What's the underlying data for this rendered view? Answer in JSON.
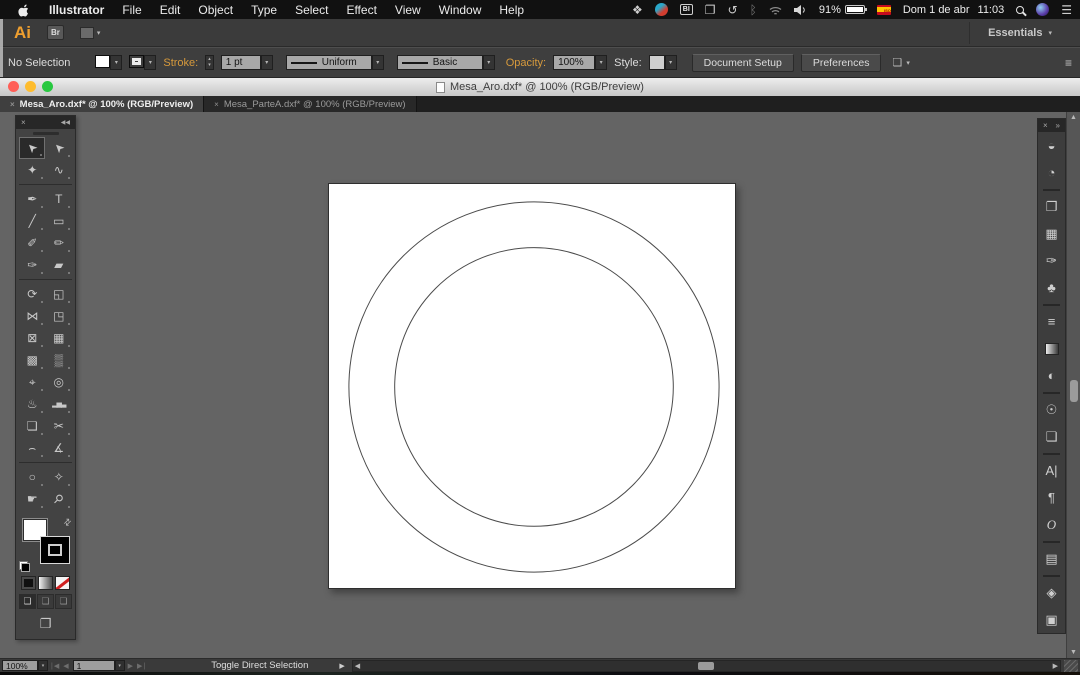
{
  "colors": {
    "accent_orange": "#ef9f2f",
    "gold_label": "#d79a3c",
    "traffic_red": "#ff5f57",
    "traffic_yellow": "#febc2e",
    "traffic_green": "#28c840",
    "flag_red": "#c60b1e",
    "flag_yellow": "#ffc400",
    "pasteboard_grey": "#646464",
    "panel_grey": "#3e3e3e",
    "artboard_white": "#ffffff",
    "circle_stroke": "#4a4a4a"
  },
  "glyphs": {
    "caret": "▾",
    "up": "▴",
    "close": "×",
    "collapse": "◀◀",
    "expand": "»",
    "swap": "⇄",
    "left": "◀",
    "right": "▶",
    "first": "|◀",
    "last": "▶|",
    "up_arrow": "▲",
    "down_arrow": "▼",
    "panel_menu": "≡",
    "notif": "☰",
    "dropbox": "❖",
    "displays": "❐",
    "time_machine": "↺",
    "bluetooth": "ᛒ",
    "select_similar": "❏",
    "screen_mode": "❐",
    "draw_normal": "❏",
    "draw_behind": "❏",
    "draw_inside": "❏",
    "grid_btn": "▦"
  },
  "menubar": {
    "items": [
      {
        "name": "menu-illustrator",
        "label": "Illustrator",
        "cls": "bold"
      },
      {
        "name": "menu-file",
        "label": "File"
      },
      {
        "name": "menu-edit",
        "label": "Edit"
      },
      {
        "name": "menu-object",
        "label": "Object"
      },
      {
        "name": "menu-type",
        "label": "Type"
      },
      {
        "name": "menu-select",
        "label": "Select"
      },
      {
        "name": "menu-effect",
        "label": "Effect"
      },
      {
        "name": "menu-view",
        "label": "View"
      },
      {
        "name": "menu-window",
        "label": "Window"
      },
      {
        "name": "menu-help",
        "label": "Help"
      }
    ],
    "status": {
      "bi_label": "BI",
      "battery_pct": "91%",
      "flag_label": "ISO",
      "date": "Dom 1 de abr",
      "time": "11:03"
    }
  },
  "appbar": {
    "logo": "Ai",
    "bridge": "Br",
    "workspace": "Essentials"
  },
  "controlbar": {
    "selection_status": "No Selection",
    "stroke_label": "Stroke:",
    "stroke_value": "1 pt",
    "width_profile": "Uniform",
    "brush": "Basic",
    "opacity_label": "Opacity:",
    "opacity_value": "100%",
    "style_label": "Style:",
    "document_setup": "Document Setup",
    "preferences": "Preferences"
  },
  "window": {
    "title": "Mesa_Aro.dxf* @ 100% (RGB/Preview)",
    "tabs": [
      {
        "name": "tab-mesa-aro",
        "close": "×",
        "label": "Mesa_Aro.dxf* @ 100% (RGB/Preview)",
        "cls": "active"
      },
      {
        "name": "tab-mesa-partea",
        "close": "×",
        "label": "Mesa_ParteA.dxf* @ 100% (RGB/Preview)"
      }
    ]
  },
  "toolbar": {
    "tools": [
      {
        "name": "tool-selection",
        "glyph": "➤",
        "cls": "active",
        "g": "arrowrot"
      },
      {
        "name": "tool-direct-selection",
        "glyph": "➤",
        "g": "arrowrot"
      },
      {
        "name": "tool-magic-wand",
        "glyph": "✦"
      },
      {
        "name": "tool-lasso",
        "glyph": "∿"
      },
      {
        "name": "tool-group-separator",
        "cls": "sep",
        "glyph": "",
        "inter": "false"
      },
      {
        "name": "tool-pen",
        "glyph": "✒"
      },
      {
        "name": "tool-type",
        "glyph": "T"
      },
      {
        "name": "tool-line-segment",
        "glyph": "╱"
      },
      {
        "name": "tool-rectangle",
        "glyph": "▭"
      },
      {
        "name": "tool-paintbrush",
        "glyph": "✐"
      },
      {
        "name": "tool-pencil",
        "glyph": "✏"
      },
      {
        "name": "tool-blob-brush",
        "glyph": "✑"
      },
      {
        "name": "tool-eraser",
        "glyph": "▰"
      },
      {
        "name": "tool-group-separator",
        "cls": "sep",
        "glyph": "",
        "inter": "false"
      },
      {
        "name": "tool-rotate",
        "glyph": "⟳"
      },
      {
        "name": "tool-scale",
        "glyph": "◱"
      },
      {
        "name": "tool-width",
        "glyph": "⋈"
      },
      {
        "name": "tool-free-transform",
        "glyph": "◳"
      },
      {
        "name": "tool-shape-builder",
        "glyph": "⊠"
      },
      {
        "name": "tool-perspective-grid",
        "glyph": "▦"
      },
      {
        "name": "tool-mesh",
        "glyph": "▩"
      },
      {
        "name": "tool-gradient",
        "glyph": "▒"
      },
      {
        "name": "tool-eyedropper",
        "glyph": "⌖"
      },
      {
        "name": "tool-blend",
        "glyph": "◎"
      },
      {
        "name": "tool-symbol-sprayer",
        "glyph": "♨"
      },
      {
        "name": "tool-column-graph",
        "glyph": "▂▅▃",
        "g": "tiny"
      },
      {
        "name": "tool-artboard",
        "glyph": "❏"
      },
      {
        "name": "tool-slice",
        "glyph": "✂"
      },
      {
        "name": "tool-curvature",
        "glyph": "⌢"
      },
      {
        "name": "tool-measure",
        "glyph": "∡"
      },
      {
        "name": "tool-group-separator",
        "cls": "sep",
        "glyph": "",
        "inter": "false"
      },
      {
        "name": "tool-ellipse",
        "glyph": "○"
      },
      {
        "name": "tool-shaper",
        "glyph": "✧"
      },
      {
        "name": "tool-hand",
        "glyph": "☛"
      },
      {
        "name": "tool-zoom",
        "glyph": "⚲",
        "g": "rot45"
      }
    ]
  },
  "rightpanel": {
    "icons": [
      {
        "name": "panel-color-icon",
        "glyph": "◒"
      },
      {
        "name": "panel-color-guide-icon",
        "glyph": "◔"
      },
      {
        "name": "panel-pathfinder-icon",
        "glyph": "❐",
        "cls": "gsep"
      },
      {
        "name": "panel-swatches-icon",
        "glyph": "▦"
      },
      {
        "name": "panel-brushes-icon",
        "glyph": "✑"
      },
      {
        "name": "panel-symbols-icon",
        "glyph": "♣"
      },
      {
        "name": "panel-stroke-icon",
        "glyph": "≡",
        "cls": "gsep"
      },
      {
        "name": "panel-gradient-icon",
        "glyph": "",
        "g": "gradsq"
      },
      {
        "name": "panel-transparency-icon",
        "glyph": "◐"
      },
      {
        "name": "panel-appearance-icon",
        "glyph": "☉",
        "cls": "gsep"
      },
      {
        "name": "panel-graphic-styles-icon",
        "glyph": "❏"
      },
      {
        "name": "panel-character-icon",
        "glyph": "A|",
        "cls": "gsep"
      },
      {
        "name": "panel-paragraph-icon",
        "glyph": "¶"
      },
      {
        "name": "panel-opentype-icon",
        "glyph": "O",
        "g": "ital"
      },
      {
        "name": "panel-align-icon",
        "glyph": "▤",
        "cls": "gsep"
      },
      {
        "name": "panel-layers-icon",
        "glyph": "◈",
        "cls": "gsep"
      },
      {
        "name": "panel-artboards-icon",
        "glyph": "▣"
      }
    ]
  },
  "statusbar": {
    "zoom": "100%",
    "artboard_number": "1",
    "status_text": "Toggle Direct Selection"
  },
  "canvas": {
    "outer_radius": 186,
    "inner_radius": 140
  }
}
